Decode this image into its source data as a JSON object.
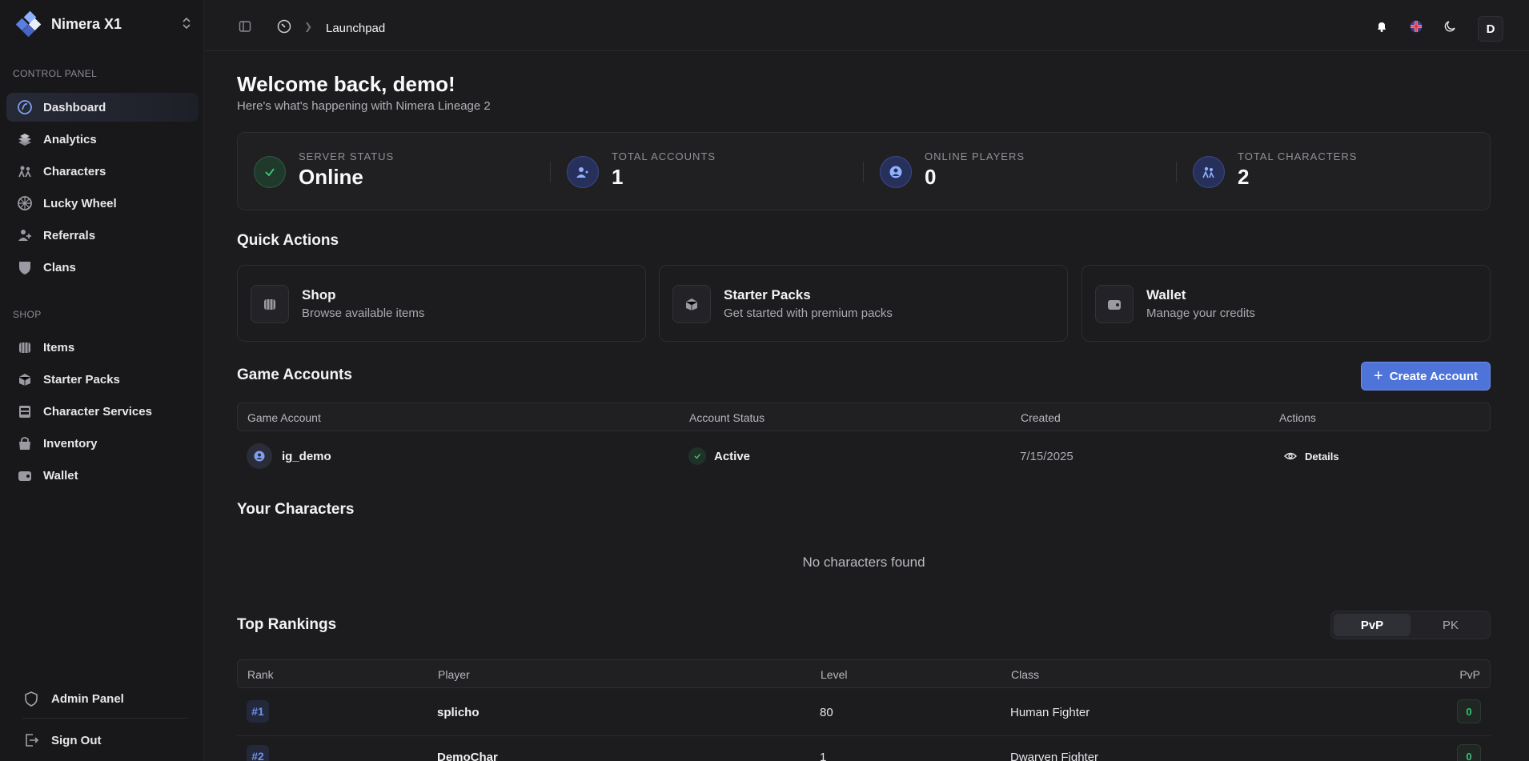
{
  "app": {
    "name": "Nimera X1"
  },
  "sidebar": {
    "control_panel_label": "CONTROL PANEL",
    "control_items": [
      {
        "label": "Dashboard",
        "icon": "dashboard-icon",
        "active": true
      },
      {
        "label": "Analytics",
        "icon": "analytics-icon"
      },
      {
        "label": "Characters",
        "icon": "characters-icon"
      },
      {
        "label": "Lucky Wheel",
        "icon": "wheel-icon"
      },
      {
        "label": "Referrals",
        "icon": "referrals-icon"
      },
      {
        "label": "Clans",
        "icon": "clans-icon"
      }
    ],
    "shop_label": "SHOP",
    "shop_items": [
      {
        "label": "Items",
        "icon": "items-icon"
      },
      {
        "label": "Starter Packs",
        "icon": "starter-packs-icon"
      },
      {
        "label": "Character Services",
        "icon": "character-services-icon"
      },
      {
        "label": "Inventory",
        "icon": "inventory-icon"
      },
      {
        "label": "Wallet",
        "icon": "wallet-icon"
      }
    ],
    "admin_panel": "Admin Panel",
    "sign_out": "Sign Out"
  },
  "topbar": {
    "breadcrumb_current": "Launchpad",
    "avatar_initial": "D"
  },
  "welcome": {
    "title": "Welcome back, demo!",
    "subtitle": "Here's what's happening with Nimera Lineage 2"
  },
  "stats": [
    {
      "label": "SERVER STATUS",
      "value": "Online",
      "color": "#2fb56a"
    },
    {
      "label": "TOTAL ACCOUNTS",
      "value": "1",
      "color": "#5b7fe0"
    },
    {
      "label": "ONLINE PLAYERS",
      "value": "0",
      "color": "#5b7fe0"
    },
    {
      "label": "TOTAL CHARACTERS",
      "value": "2",
      "color": "#5b7fe0"
    }
  ],
  "quick_actions": {
    "title": "Quick Actions",
    "cards": [
      {
        "title": "Shop",
        "subtitle": "Browse available items"
      },
      {
        "title": "Starter Packs",
        "subtitle": "Get started with premium packs"
      },
      {
        "title": "Wallet",
        "subtitle": "Manage your credits"
      }
    ]
  },
  "game_accounts": {
    "title": "Game Accounts",
    "create_button": "Create Account",
    "columns": [
      "Game Account",
      "Account Status",
      "Created",
      "Actions"
    ],
    "rows": [
      {
        "account": "ig_demo",
        "status": "Active",
        "created": "7/15/2025",
        "action": "Details"
      }
    ]
  },
  "characters": {
    "title": "Your Characters",
    "empty": "No characters found"
  },
  "rankings": {
    "title": "Top Rankings",
    "tabs": [
      "PvP",
      "PK"
    ],
    "active_tab": "PvP",
    "columns": [
      "Rank",
      "Player",
      "Level",
      "Class",
      "PvP"
    ],
    "rows": [
      {
        "rank": "#1",
        "player": "splicho",
        "level": "80",
        "class": "Human Fighter",
        "pvp": "0"
      },
      {
        "rank": "#2",
        "player": "DemoChar",
        "level": "1",
        "class": "Dwarven Fighter",
        "pvp": "0"
      }
    ]
  },
  "colors": {
    "accent": "#4f74d9",
    "success": "#2fb56a",
    "background": "#1c1c1f",
    "sidebar": "#18181b"
  }
}
